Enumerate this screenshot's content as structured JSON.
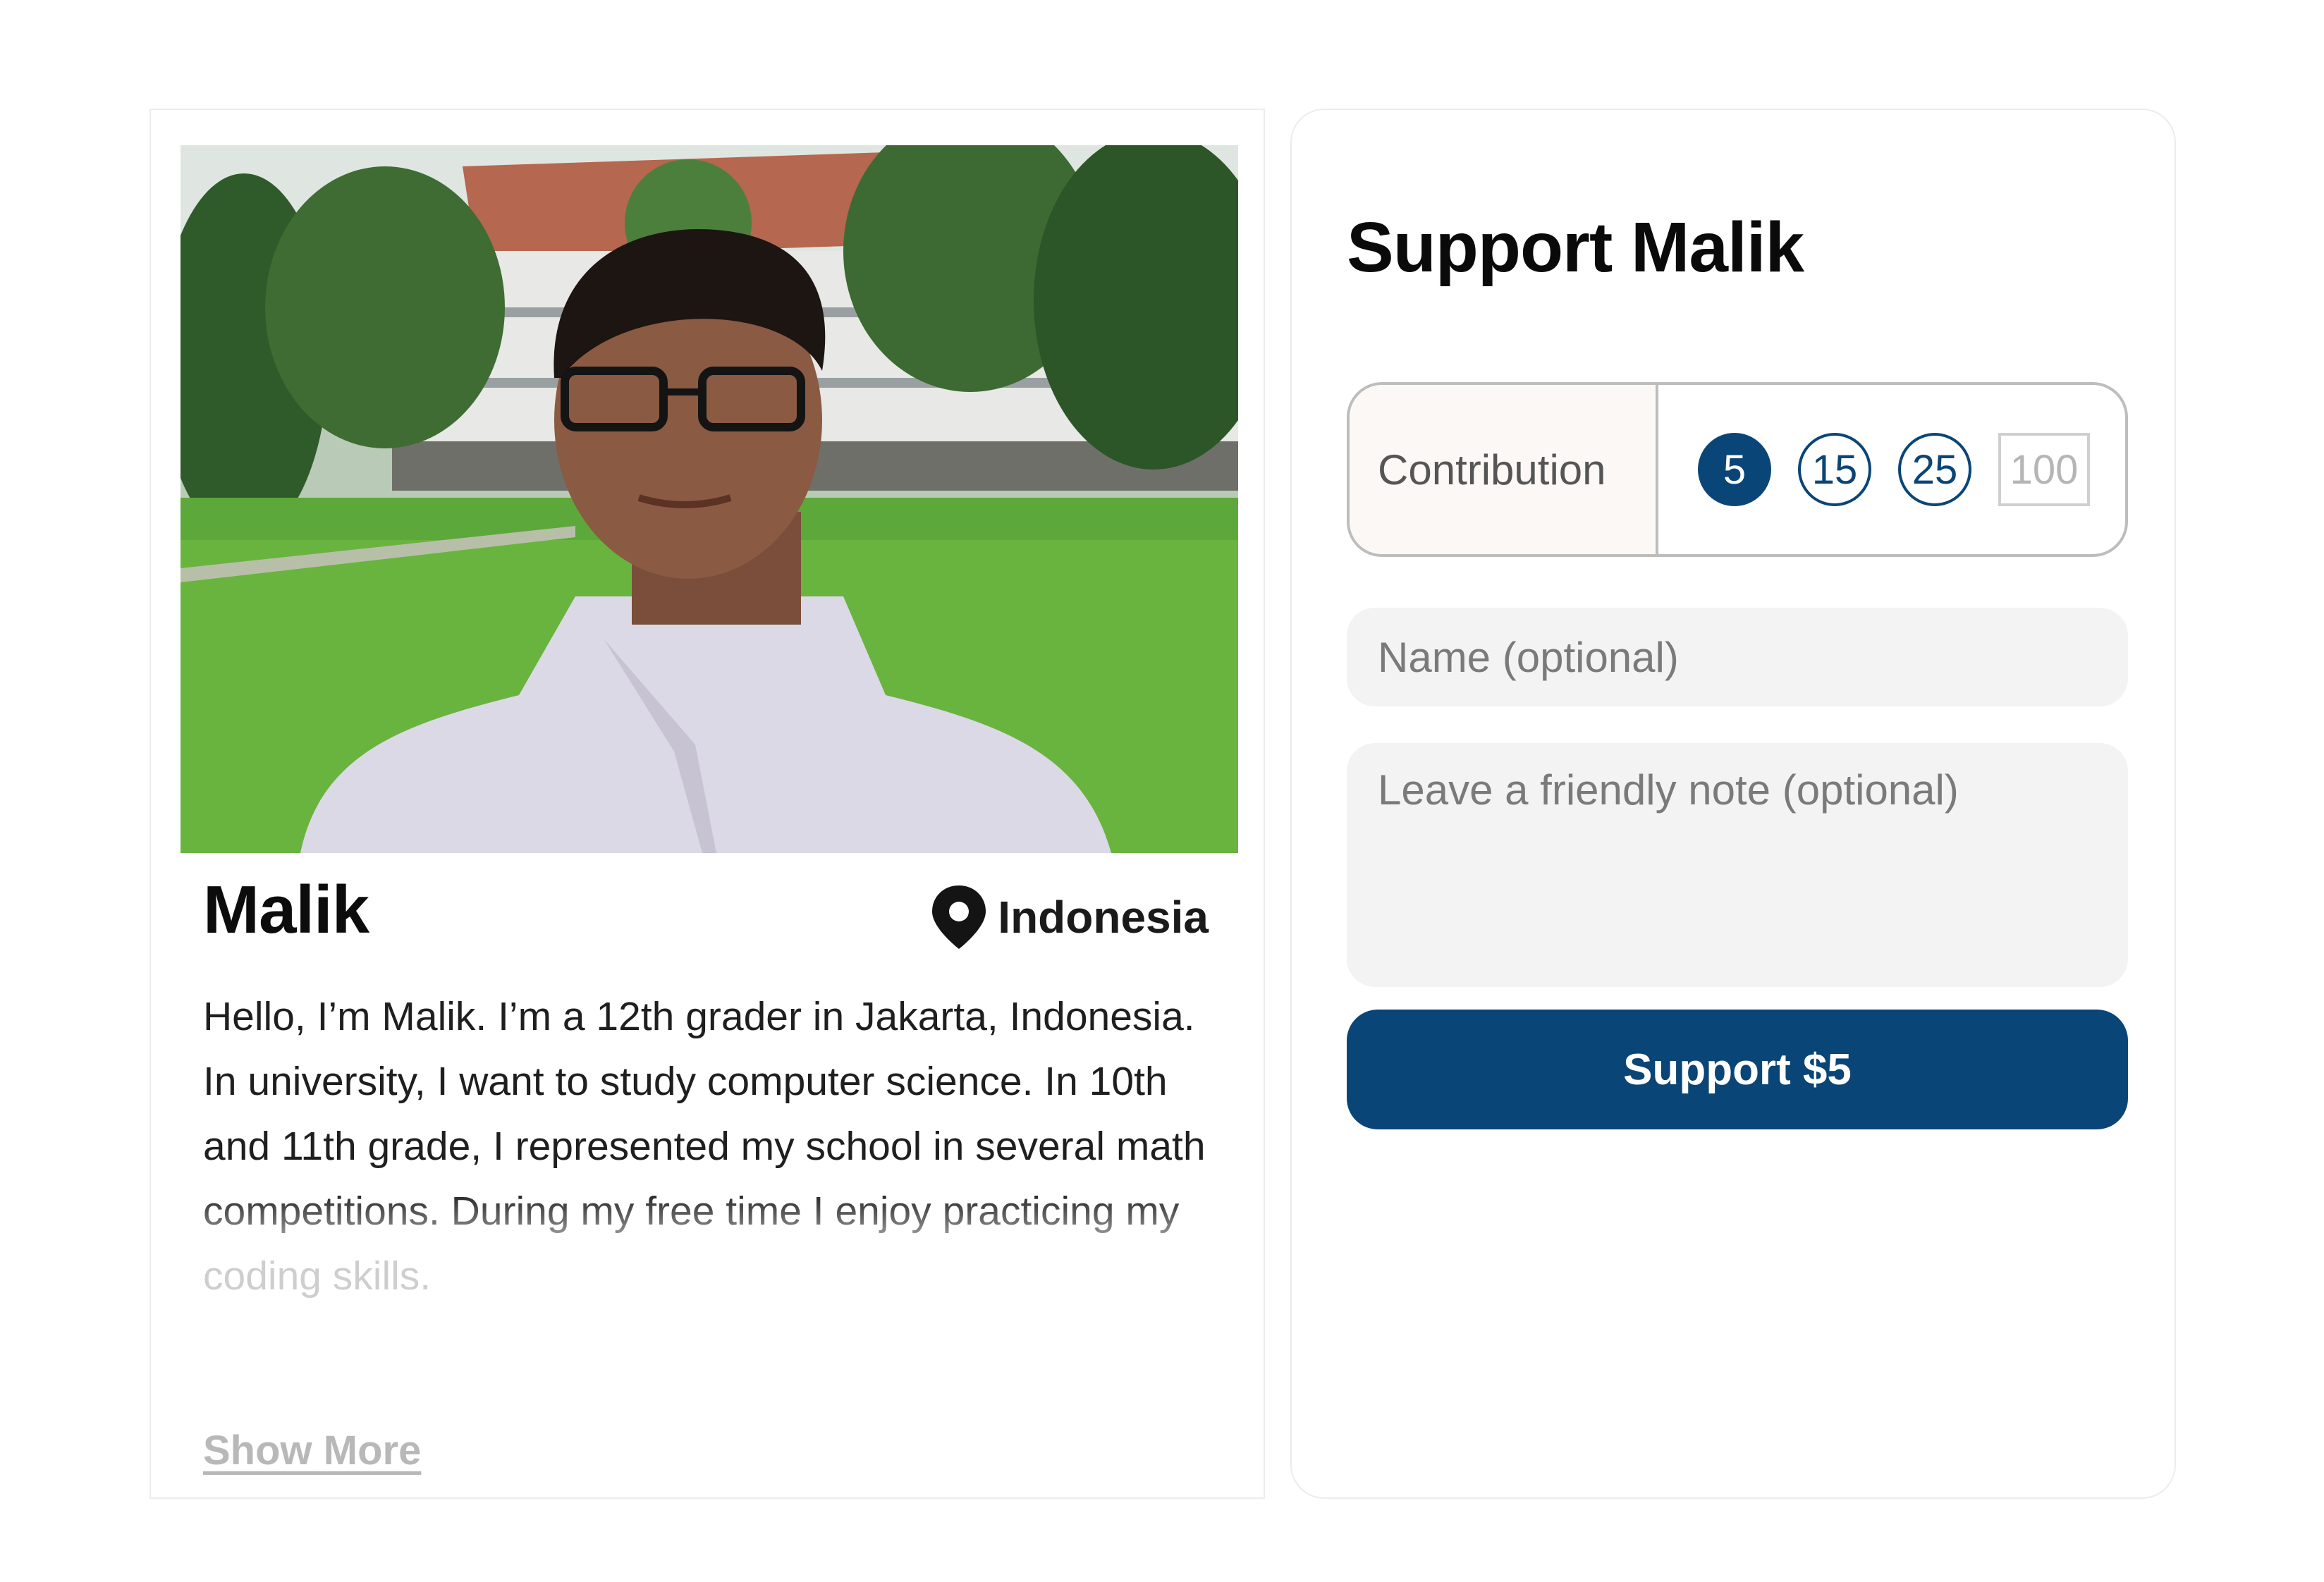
{
  "profile": {
    "name": "Malik",
    "location": "Indonesia",
    "bio": "Hello, I’m Malik. I’m a 12th grader in Jakarta, Indonesia. In university, I want to study computer science. In 10th and 11th grade, I represented my school in several math competitions. During my free time I enjoy practicing my coding skills.",
    "show_more_label": "Show More",
    "photo_icon": "student-photo",
    "location_icon": "map-pin-icon"
  },
  "support": {
    "title": "Support Malik",
    "contribution_label": "Contribution",
    "amounts": [
      {
        "value": "5",
        "state": "selected"
      },
      {
        "value": "15",
        "state": "default"
      },
      {
        "value": "25",
        "state": "default"
      },
      {
        "value": "100",
        "state": "disabled"
      }
    ],
    "name_placeholder": "Name (optional)",
    "note_placeholder": "Leave a friendly note (optional)",
    "button_label": "Support $5"
  },
  "colors": {
    "accent": "#0a4577",
    "field_bg": "#f3f3f3",
    "label_bg": "#fbf8f5"
  }
}
